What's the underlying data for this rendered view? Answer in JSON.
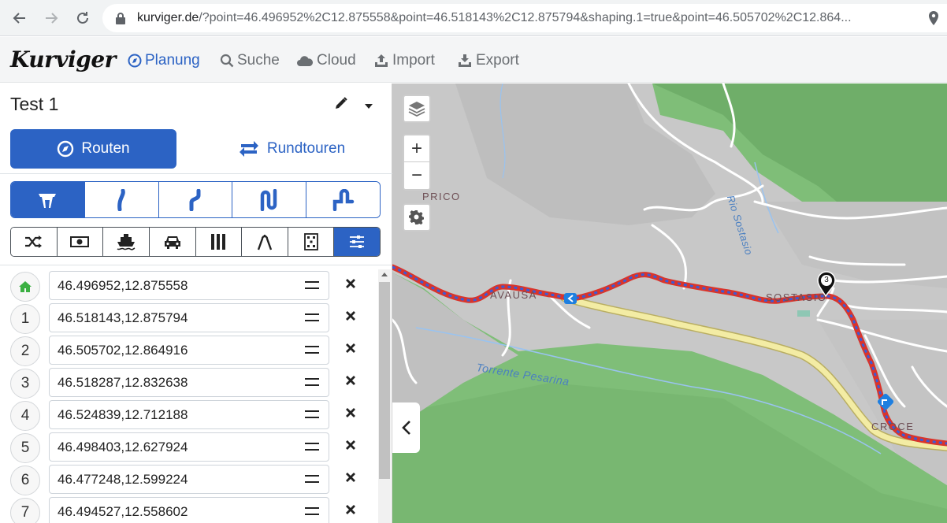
{
  "browser": {
    "url_host": "kurviger.de",
    "url_rest": "/?point=46.496952%2C12.875558&point=46.518143%2C12.875794&shaping.1=true&point=46.505702%2C12.864..."
  },
  "header": {
    "logo": "Kurviger",
    "menu": [
      {
        "label": "Planung"
      },
      {
        "label": "Suche"
      },
      {
        "label": "Cloud"
      },
      {
        "label": "Import"
      },
      {
        "label": "Export"
      }
    ]
  },
  "sidebar": {
    "tour_title": "Test 1",
    "routen_label": "Routen",
    "rundtouren_label": "Rundtouren",
    "waypoints": [
      {
        "num": "",
        "coords": "46.496952,12.875558"
      },
      {
        "num": "1",
        "coords": "46.518143,12.875794"
      },
      {
        "num": "2",
        "coords": "46.505702,12.864916"
      },
      {
        "num": "3",
        "coords": "46.518287,12.832638"
      },
      {
        "num": "4",
        "coords": "46.524839,12.712188"
      },
      {
        "num": "5",
        "coords": "46.498403,12.627924"
      },
      {
        "num": "6",
        "coords": "46.477248,12.599224"
      },
      {
        "num": "7",
        "coords": "46.494527,12.558602"
      }
    ]
  },
  "map": {
    "labels": {
      "prico": "PRICO",
      "avausa": "AVAUSA",
      "sostasio": "SOSTASIO",
      "croce": "CROCE",
      "rio": "Rio Sostasio",
      "torrente": "Torrente Pesarina"
    },
    "marker_number": "3",
    "colors": {
      "route_red": "#d9342b",
      "route_blue": "#3b5bd6",
      "road_yellow": "#f1e9a0"
    }
  },
  "colors": {
    "accent": "#2c63c4"
  }
}
